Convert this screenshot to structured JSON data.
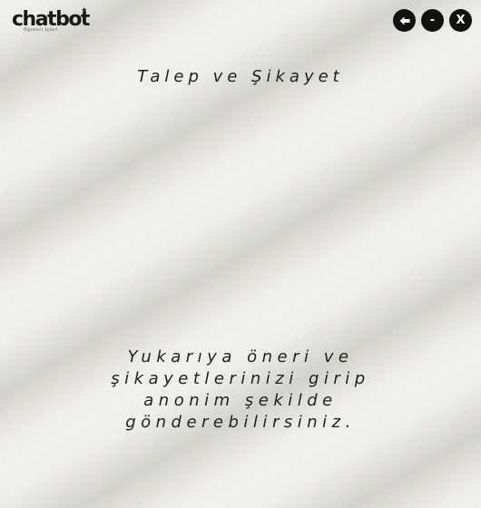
{
  "header": {
    "logo_text": "chatbot",
    "logo_subtitle": "Öğrenci İşleri",
    "controls": {
      "back_icon": "back-arrow-icon",
      "minimize_label": "-",
      "close_label": "X"
    }
  },
  "main": {
    "title": "Talep ve Şikayet",
    "message_lines": [
      "Yukarıya öneri ve",
      "şikayetlerinizi girip",
      "anonim şekilde",
      "gönderebilirsiniz."
    ]
  }
}
